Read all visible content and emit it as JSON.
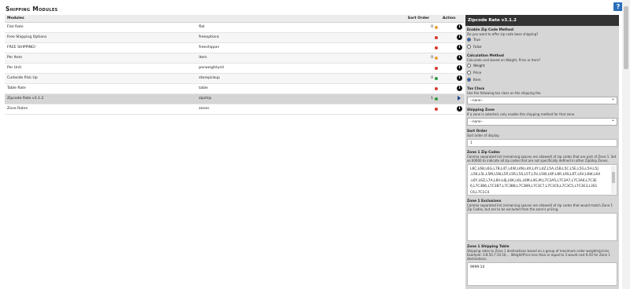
{
  "help_label": "?",
  "page_title": "Shipping Modules",
  "table": {
    "headers": {
      "modules": "Modules",
      "sort_order": "Sort Order",
      "action": "Action"
    },
    "rows": [
      {
        "title": "Flat Rate",
        "code": "flat",
        "sort": "0",
        "status": "orange"
      },
      {
        "title": "Free Shipping Options",
        "code": "freeoptions",
        "sort": "",
        "status": "red"
      },
      {
        "title": "FREE SHIPPING!",
        "code": "freeshipper",
        "sort": "",
        "status": "red"
      },
      {
        "title": "Per Item",
        "code": "item",
        "sort": "0",
        "status": "orange"
      },
      {
        "title": "Per Unit",
        "code": "perweightunit",
        "sort": "",
        "status": "red"
      },
      {
        "title": "Curbside Pick Up",
        "code": "storepickup",
        "sort": "0",
        "status": "green"
      },
      {
        "title": "Table Rate",
        "code": "table",
        "sort": "",
        "status": "red"
      },
      {
        "title": "Zipcode Rate v3.1.2",
        "code": "zipship",
        "sort": "1",
        "status": "green"
      },
      {
        "title": "Zone Rates",
        "code": "zones",
        "sort": "",
        "status": "red"
      }
    ]
  },
  "colors": {
    "orange": "#e8a23a",
    "red": "#d83a2c",
    "green": "#2e9a3e"
  },
  "panel": {
    "title": "Zipcode Rate v3.1.2",
    "enable": {
      "title": "Enable Zip Code Method",
      "desc": "Do you want to offer zip code base shipping?",
      "options": [
        "True",
        "False"
      ],
      "selected": 0
    },
    "calc": {
      "title": "Calculation Method",
      "desc": "Calculate cost based on Weight, Price or Item?",
      "options": [
        "Weight",
        "Price",
        "Item"
      ],
      "selected": 2
    },
    "tax": {
      "title": "Tax Class",
      "desc": "Use the following tax class on the shipping fee.",
      "value": "--none--"
    },
    "zone": {
      "title": "Shipping Zone",
      "desc": "If a zone is selected, only enable this shipping method for that zone.",
      "value": "--none--"
    },
    "sort": {
      "title": "Sort Order",
      "desc": "Sort order of display.",
      "value": "1"
    },
    "zips": {
      "title": "Zone 1 Zip Codes",
      "desc": "Comma separated list (remaining spaces are allowed) of zip codes that are part of Zone 1. Set as 00000 to indicate all zip codes that are not specifically defined in other ZipShip Zones.",
      "lines": [
        "L6C,L6B,L6G,L7B,L4T,L4W,L4N,L4X,L4Y,L4Z,L5A,L5B,L5C,L5E,L5G,L5H,L5J",
        ",L5K,L5L,L5M,L5N,L5P,L5R,L5S,L5T,L5V,L5W,L6P,L6R,L6S,L6T,L6V,L6W,L6X",
        ",L6Y,L6Z,L7A,L6H,L6J,L6K,L6L,L6M,L4G,M,L7C3A5,L7C3A7,L7C3A6,L7C3E",
        "6,L7C3B6,L7C3B7,L7C3B8,L7C3B9,L7C3C7,L7C3C6,L7C3C5,L7C3E3,L3S1",
        "C6,L7C1C4"
      ]
    },
    "exclusions": {
      "title": "Zone 1 Exclusions",
      "desc": "Comma separated list (remaining spaces are allowed) of zip codes that would match Zone 1 Zip Codes, but are to be excluded from the zone's pricing."
    },
    "shipping_table": {
      "title": "Zone 1 Shipping Table",
      "desc": "Shipping rates to Zone 1 destinations based on a group of maximum order weights/prices. Example: 3:8.50,7:10.50,... Weight/Price less than or equal to 3 would cost 8.50 for Zone 1 destinations.",
      "value": "9999:10"
    }
  }
}
